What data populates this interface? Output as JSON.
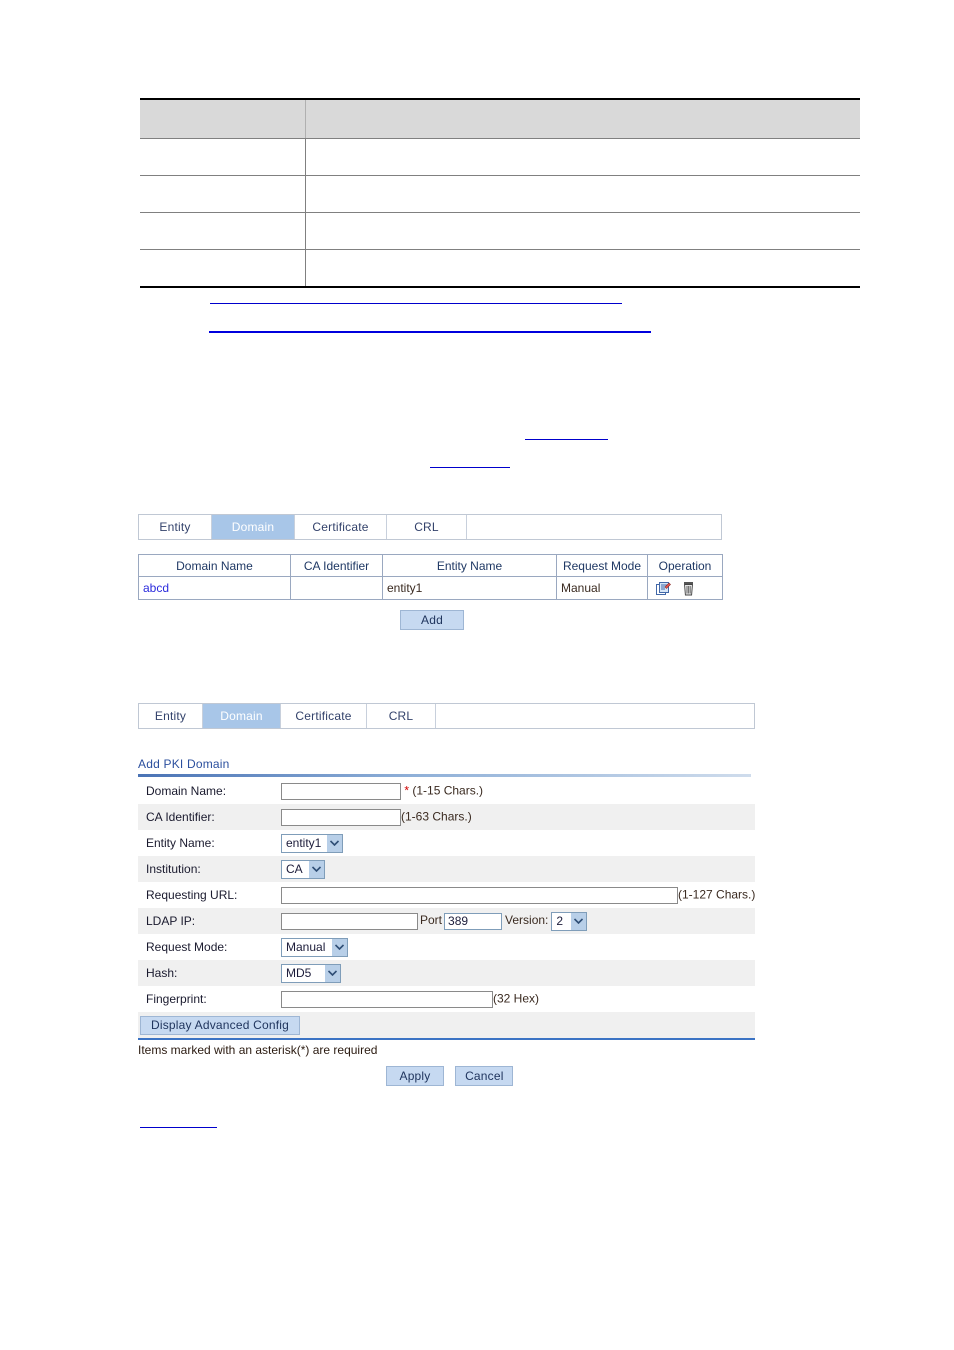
{
  "doc_table": {
    "header": [
      "",
      ""
    ],
    "rows": [
      [
        "",
        ""
      ],
      [
        "",
        ""
      ],
      [
        "",
        ""
      ],
      [
        "",
        ""
      ]
    ]
  },
  "links": [
    {
      "name": "inline-link-1",
      "text": ""
    },
    {
      "name": "inline-link-2",
      "text": ""
    },
    {
      "name": "inline-link-3",
      "text": ""
    },
    {
      "name": "inline-link-4",
      "text": ""
    },
    {
      "name": "inline-link-5",
      "text": ""
    }
  ],
  "list_panel": {
    "tabs": [
      {
        "label": "Entity",
        "active": false
      },
      {
        "label": "Domain",
        "active": true
      },
      {
        "label": "Certificate",
        "active": false
      },
      {
        "label": "CRL",
        "active": false
      }
    ],
    "table": {
      "columns": [
        "Domain Name",
        "CA Identifier",
        "Entity Name",
        "Request Mode",
        "Operation"
      ],
      "rows": [
        {
          "domain_name": "abcd",
          "ca_identifier": "",
          "entity_name": "entity1",
          "request_mode": "Manual",
          "operations": [
            "edit-icon",
            "delete-icon"
          ]
        }
      ]
    },
    "add_button": "Add"
  },
  "form_panel": {
    "tabs": [
      {
        "label": "Entity",
        "active": false
      },
      {
        "label": "Domain",
        "active": true
      },
      {
        "label": "Certificate",
        "active": false
      },
      {
        "label": "CRL",
        "active": false
      }
    ],
    "title": "Add PKI Domain",
    "fields": {
      "domain_name": {
        "label": "Domain Name:",
        "value": "",
        "required_mark": "*",
        "hint": "(1-15 Chars.)"
      },
      "ca_identifier": {
        "label": "CA Identifier:",
        "value": "",
        "hint": "(1-63 Chars.)"
      },
      "entity_name": {
        "label": "Entity Name:",
        "value": "entity1"
      },
      "institution": {
        "label": "Institution:",
        "value": "CA"
      },
      "requesting_url": {
        "label": "Requesting URL:",
        "value": "",
        "hint": "(1-127 Chars.)"
      },
      "ldap_ip": {
        "label": "LDAP IP:",
        "value": "",
        "port_label": "Port",
        "port_value": "389",
        "version_label": "Version:",
        "version_value": "2"
      },
      "request_mode": {
        "label": "Request Mode:",
        "value": "Manual"
      },
      "hash": {
        "label": "Hash:",
        "value": "MD5"
      },
      "fingerprint": {
        "label": "Fingerprint:",
        "value": "",
        "hint": "(32 Hex)"
      }
    },
    "advanced_button": "Display Advanced Config",
    "footnote": "Items marked with an asterisk(*) are required",
    "apply_button": "Apply",
    "cancel_button": "Cancel"
  },
  "colors": {
    "tab_active_bg": "#a8c6e8",
    "button_bg": "#c6d9f1",
    "link": "#2b2bdd",
    "title": "#2b4f9e",
    "required": "#d00000",
    "rule": "#0000cc"
  }
}
